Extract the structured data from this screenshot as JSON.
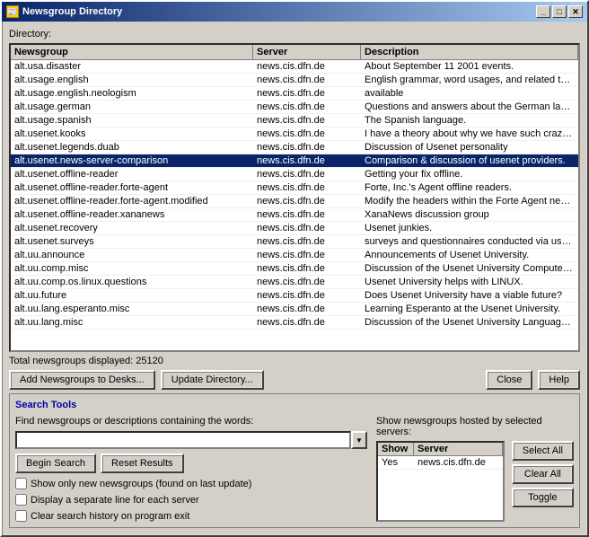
{
  "window": {
    "title": "Newsgroup Directory",
    "title_icon": "📰"
  },
  "directory_label": "Directory:",
  "table": {
    "columns": [
      "Newsgroup",
      "Server",
      "Description"
    ],
    "rows": [
      {
        "newsgroup": "alt.usa.disaster",
        "server": "news.cis.dfn.de",
        "description": "About September 11 2001 events.",
        "selected": false
      },
      {
        "newsgroup": "alt.usage.english",
        "server": "news.cis.dfn.de",
        "description": "English grammar, word usages, and related topics.",
        "selected": false
      },
      {
        "newsgroup": "alt.usage.english.neologism",
        "server": "news.cis.dfn.de",
        "description": "available",
        "selected": false
      },
      {
        "newsgroup": "alt.usage.german",
        "server": "news.cis.dfn.de",
        "description": "Questions and answers about the German language",
        "selected": false
      },
      {
        "newsgroup": "alt.usage.spanish",
        "server": "news.cis.dfn.de",
        "description": "The Spanish language.",
        "selected": false
      },
      {
        "newsgroup": "alt.usenet.kooks",
        "server": "news.cis.dfn.de",
        "description": "I have a theory about why we have such crazy the",
        "selected": false
      },
      {
        "newsgroup": "alt.usenet.legends.duab",
        "server": "news.cis.dfn.de",
        "description": "Discussion of Usenet personality",
        "selected": false
      },
      {
        "newsgroup": "alt.usenet.news-server-comparison",
        "server": "news.cis.dfn.de",
        "description": "Comparison & discussion of usenet providers.",
        "selected": true
      },
      {
        "newsgroup": "alt.usenet.offline-reader",
        "server": "news.cis.dfn.de",
        "description": "Getting your fix offline.",
        "selected": false
      },
      {
        "newsgroup": "alt.usenet.offline-reader.forte-agent",
        "server": "news.cis.dfn.de",
        "description": "Forte, Inc.'s Agent offline readers.",
        "selected": false
      },
      {
        "newsgroup": "alt.usenet.offline-reader.forte-agent.modified",
        "server": "news.cis.dfn.de",
        "description": "Modify the headers within the Forte Agent news re",
        "selected": false
      },
      {
        "newsgroup": "alt.usenet.offline-reader.xananews",
        "server": "news.cis.dfn.de",
        "description": "XanaNews discussion group",
        "selected": false
      },
      {
        "newsgroup": "alt.usenet.recovery",
        "server": "news.cis.dfn.de",
        "description": "Usenet junkies.",
        "selected": false
      },
      {
        "newsgroup": "alt.usenet.surveys",
        "server": "news.cis.dfn.de",
        "description": "surveys and questionnaires conducted via usenet",
        "selected": false
      },
      {
        "newsgroup": "alt.uu.announce",
        "server": "news.cis.dfn.de",
        "description": "Announcements of Usenet University.",
        "selected": false
      },
      {
        "newsgroup": "alt.uu.comp.misc",
        "server": "news.cis.dfn.de",
        "description": "Discussion of the Usenet University Computer Dep",
        "selected": false
      },
      {
        "newsgroup": "alt.uu.comp.os.linux.questions",
        "server": "news.cis.dfn.de",
        "description": "Usenet University helps with LINUX.",
        "selected": false
      },
      {
        "newsgroup": "alt.uu.future",
        "server": "news.cis.dfn.de",
        "description": "Does Usenet University have a viable future?",
        "selected": false
      },
      {
        "newsgroup": "alt.uu.lang.esperanto.misc",
        "server": "news.cis.dfn.de",
        "description": "Learning Esperanto at the Usenet University.",
        "selected": false
      },
      {
        "newsgroup": "alt.uu.lang.misc",
        "server": "news.cis.dfn.de",
        "description": "Discussion of the Usenet University Language Dep",
        "selected": false
      }
    ]
  },
  "total_label": "Total newsgroups displayed: 25120",
  "buttons": {
    "add_newsgroups": "Add Newsgroups to Desks...",
    "update_directory": "Update Directory...",
    "close": "Close",
    "help": "Help"
  },
  "search_tools": {
    "title": "Search Tools",
    "find_label": "Find newsgroups or descriptions containing the words:",
    "find_placeholder": "",
    "server_label": "Show newsgroups hosted by selected servers:",
    "server_columns": [
      "Show",
      "Server"
    ],
    "server_rows": [
      {
        "show": "Yes",
        "server": "news.cis.dfn.de"
      }
    ],
    "buttons": {
      "begin_search": "Begin Search",
      "reset_results": "Reset Results",
      "select_all": "Select All",
      "clear_all": "Clear All",
      "toggle": "Toggle"
    },
    "checkboxes": [
      {
        "label": "Show only new newsgroups (found on last update)",
        "checked": false
      },
      {
        "label": "Display a separate line for each server",
        "checked": false
      },
      {
        "label": "Clear search history on program exit",
        "checked": false
      }
    ]
  },
  "title_buttons": {
    "minimize": "_",
    "maximize": "□",
    "close": "✕"
  }
}
